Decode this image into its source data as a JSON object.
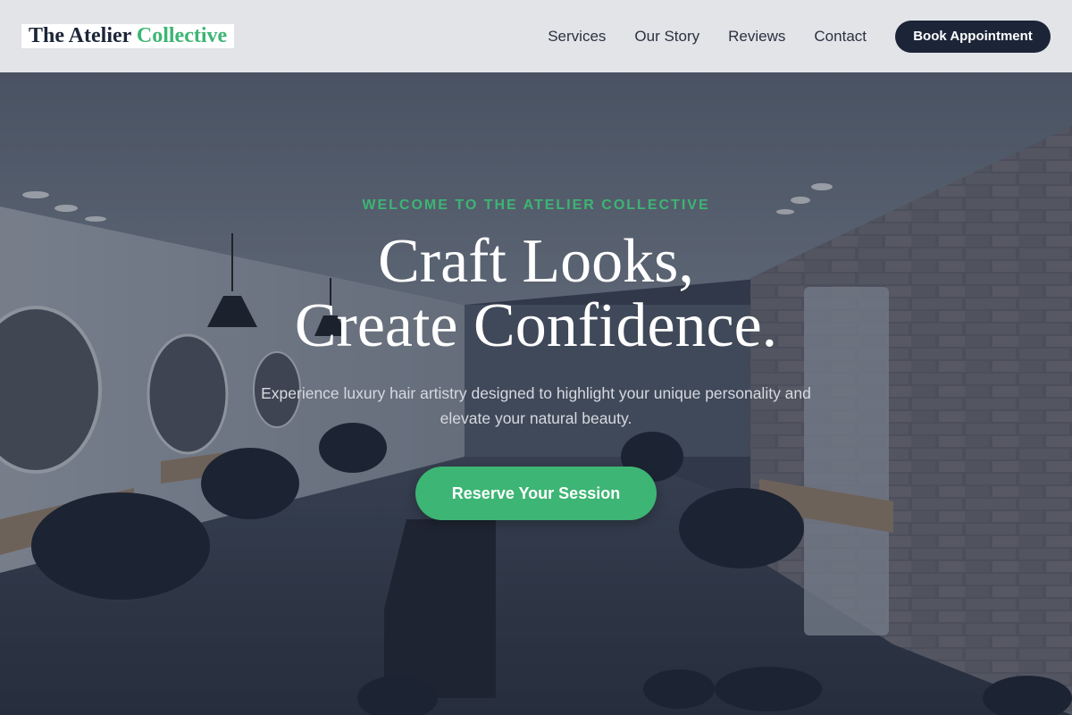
{
  "brand": {
    "name_primary": "The Atelier",
    "name_accent": "Collective"
  },
  "nav": {
    "items": [
      {
        "label": "Services"
      },
      {
        "label": "Our Story"
      },
      {
        "label": "Reviews"
      },
      {
        "label": "Contact"
      }
    ],
    "book_label": "Book Appointment"
  },
  "hero": {
    "eyebrow": "WELCOME TO THE ATELIER COLLECTIVE",
    "headline_line1": "Craft Looks,",
    "headline_line2": "Create Confidence.",
    "subtitle": "Experience luxury hair artistry designed to highlight your unique personality and elevate your natural beauty.",
    "cta_label": "Reserve Your Session"
  },
  "colors": {
    "brand_dark": "#1c2538",
    "accent_green": "#3db574",
    "header_bg": "#e3e4e8"
  }
}
